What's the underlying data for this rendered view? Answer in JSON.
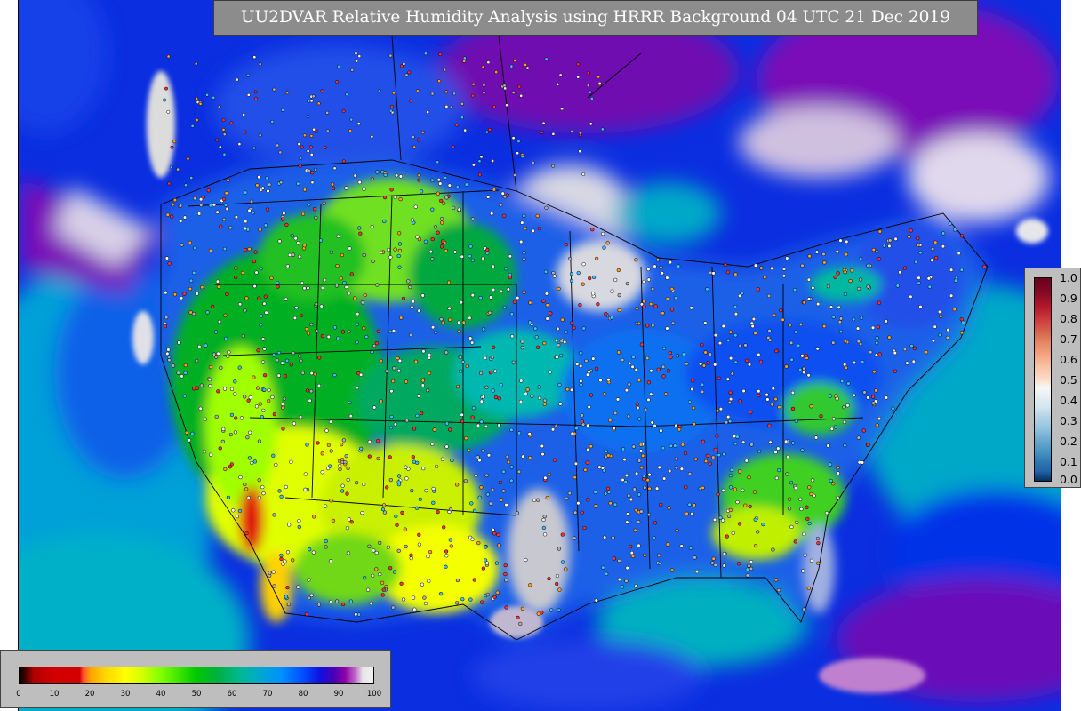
{
  "title": "UU2DVAR Relative Humidity Analysis using HRRR Background 04 UTC 21 Dec 2019",
  "right_colorbar": {
    "ticks": [
      "1.0",
      "0.9",
      "0.8",
      "0.7",
      "0.6",
      "0.5",
      "0.4",
      "0.3",
      "0.2",
      "0.1",
      "0.0"
    ]
  },
  "bottom_colorbar": {
    "ticks": [
      "0",
      "10",
      "20",
      "30",
      "40",
      "50",
      "60",
      "70",
      "80",
      "90",
      "100"
    ]
  },
  "colors": {
    "ocean_low": "#00a8d0",
    "ocean_high": "#0a1ee6",
    "very_moist": "#8c00a8",
    "saturated": "#d8d8d8",
    "moist": "#0078ff",
    "medium": "#00b400",
    "dry": "#80ff00",
    "very_dry": "#ffff00",
    "extreme_dry": "#d40000"
  }
}
